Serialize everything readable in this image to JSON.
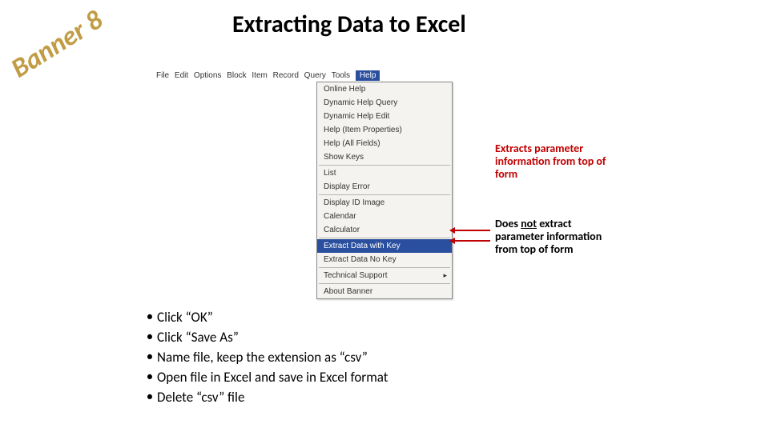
{
  "stamp": "Banner 8",
  "title": "Extracting Data to Excel",
  "menubar": {
    "items": [
      "File",
      "Edit",
      "Options",
      "Block",
      "Item",
      "Record",
      "Query",
      "Tools"
    ],
    "selected": "Help"
  },
  "dropdown": {
    "items": [
      {
        "label": "Online Help"
      },
      {
        "label": "Dynamic Help Query"
      },
      {
        "label": "Dynamic Help Edit"
      },
      {
        "label": "Help (Item Properties)"
      },
      {
        "label": "Help (All Fields)"
      },
      {
        "label": "Show Keys"
      },
      {
        "divider": true
      },
      {
        "label": "List"
      },
      {
        "label": "Display Error"
      },
      {
        "divider": true
      },
      {
        "label": "Display ID Image"
      },
      {
        "label": "Calendar"
      },
      {
        "label": "Calculator"
      },
      {
        "divider": true
      },
      {
        "label": "Extract Data with Key",
        "hl": true
      },
      {
        "label": "Extract Data No Key"
      },
      {
        "divider": true
      },
      {
        "label": "Technical Support",
        "sub": true
      },
      {
        "divider": true
      },
      {
        "label": "About Banner"
      }
    ]
  },
  "callouts": {
    "c1": "Extracts parameter information from top of form",
    "c2_pre": "Does ",
    "c2_not": "not",
    "c2_post": " extract parameter information from top of form"
  },
  "bullets": [
    "Click “OK”",
    "Click “Save As”",
    "Name file, keep the extension as “csv”",
    "Open file in Excel and save in Excel format",
    "Delete “csv” file"
  ]
}
